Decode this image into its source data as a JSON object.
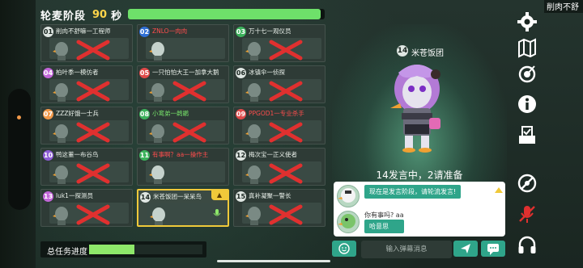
{
  "header": {
    "phase": "轮麦阶段",
    "seconds": "90",
    "unit": "秒",
    "time_remaining_fraction": 0.98
  },
  "players": [
    {
      "num": "01",
      "name": "削肉不舒嘛一工程师",
      "name_style": "normal",
      "num_color": "#dfe6e2",
      "eliminated": true
    },
    {
      "num": "02",
      "name": "ZNLO一肉肉",
      "name_style": "red",
      "num_color": "#2f6fd6",
      "eliminated": false
    },
    {
      "num": "03",
      "name": "万十七一观仪员",
      "name_style": "normal",
      "num_color": "#3cb25c",
      "eliminated": true
    },
    {
      "num": "04",
      "name": "柏叶季一模仿者",
      "name_style": "normal",
      "num_color": "#c266d8",
      "eliminated": true
    },
    {
      "num": "05",
      "name": "一只怕怕大王一加拿大鹅",
      "name_style": "normal",
      "num_color": "#e04a4a",
      "eliminated": true
    },
    {
      "num": "06",
      "name": "冰镇伞一侦探",
      "name_style": "normal",
      "num_color": "#dfe6e2",
      "eliminated": true
    },
    {
      "num": "07",
      "name": "ZZZ好饿一士兵",
      "name_style": "normal",
      "num_color": "#f2994a",
      "eliminated": true
    },
    {
      "num": "08",
      "name": "小鸾弟一鹈鹕",
      "name_style": "green",
      "num_color": "#3cb25c",
      "eliminated": true
    },
    {
      "num": "09",
      "name": "PPGOD1一专业杀手",
      "name_style": "red",
      "num_color": "#e04a4a",
      "eliminated": true
    },
    {
      "num": "10",
      "name": "鸭这董一布谷鸟",
      "name_style": "normal",
      "num_color": "#8e5cd6",
      "eliminated": true
    },
    {
      "num": "11",
      "name": "有事啊？aa一操作主",
      "name_style": "red",
      "num_color": "#3cb25c",
      "eliminated": false
    },
    {
      "num": "12",
      "name": "梅次宝一正义使者",
      "name_style": "normal",
      "num_color": "#dfe6e2",
      "eliminated": true
    },
    {
      "num": "13",
      "name": "luk1一探测员",
      "name_style": "normal",
      "num_color": "#c266d8",
      "eliminated": true
    },
    {
      "num": "14",
      "name": "米苍饭团一呆呆鸟",
      "name_style": "normal",
      "num_color": "#dfe6e2",
      "eliminated": false,
      "selected": true,
      "tag_icon": "speaker-tag-icon"
    },
    {
      "num": "15",
      "name": "真补凝聚一警长",
      "name_style": "normal",
      "num_color": "#dfe6e2",
      "eliminated": true
    }
  ],
  "task": {
    "label": "总任务进度",
    "progress_fraction": 0.4
  },
  "speaker": {
    "num": "14",
    "name": "米苍饭团",
    "status": "14发言中，2请准备"
  },
  "chat": {
    "messages": [
      {
        "sender": "",
        "text": "现在是发言阶段，请轮流发言!"
      },
      {
        "sender": "你有事吗? aa",
        "text": "哈意思"
      }
    ]
  },
  "input": {
    "placeholder": "输入弹幕消息"
  },
  "top_right_label": "削肉不舒",
  "sidebar_icons": [
    "gear-icon",
    "map-icon",
    "target-icon",
    "info-icon",
    "vote-box-icon",
    "mute-icon",
    "mic-off-icon",
    "headphone-icon"
  ],
  "colors": {
    "accent_green": "#2fa58a",
    "progress_green": "#6ee06a",
    "highlight_yellow": "#f0c93a",
    "cross_red": "#e0302f"
  }
}
